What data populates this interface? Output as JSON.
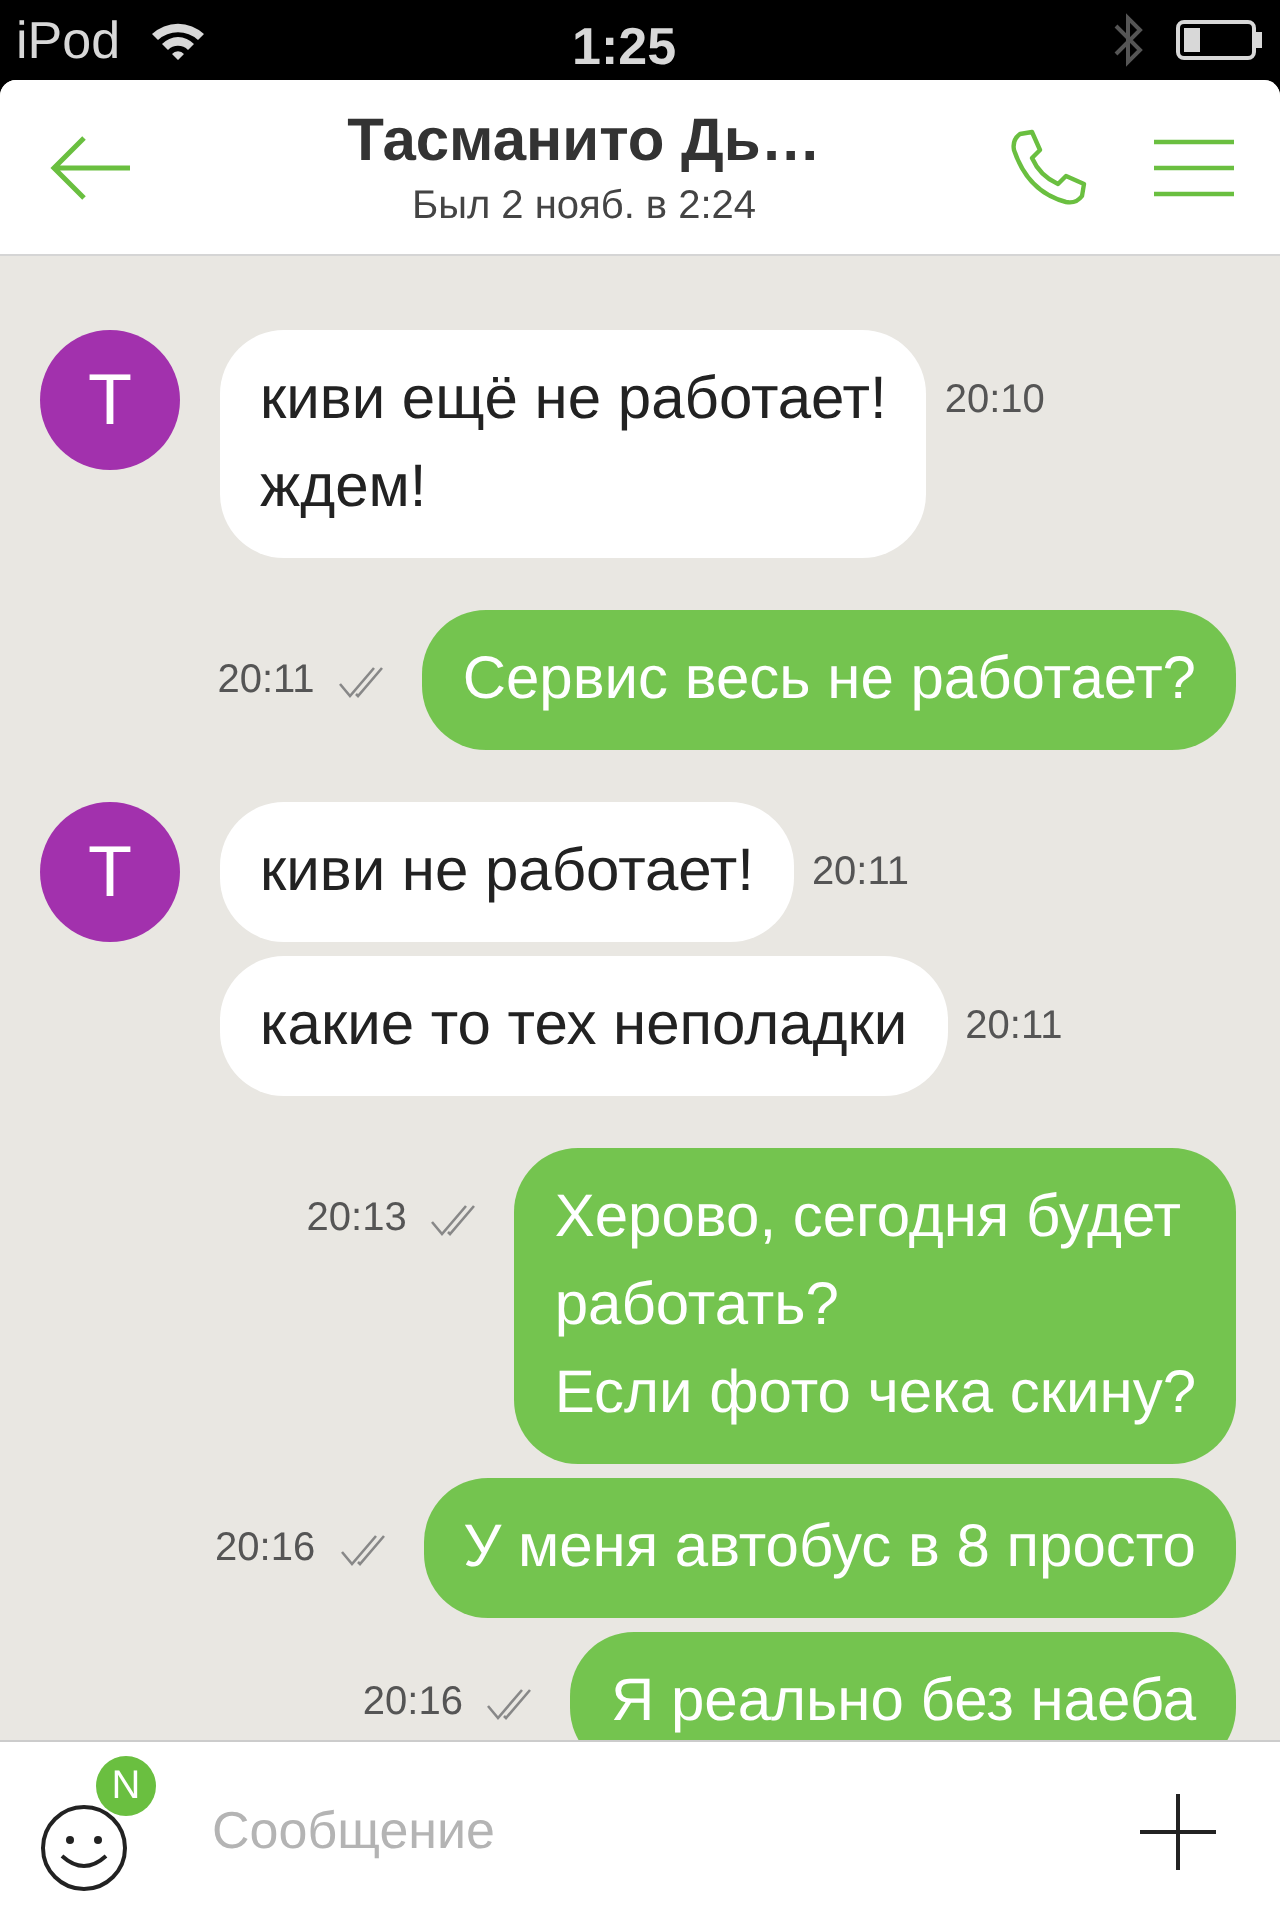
{
  "status_bar": {
    "carrier": "iPod",
    "time": "1:25"
  },
  "header": {
    "title": "Тасманито Дь…",
    "subtitle": "Был 2 нояб. в 2:24"
  },
  "messages": [
    {
      "kind": "incoming",
      "avatar": "Т",
      "text": "киви ещё не работает!\nждем!",
      "time": "20:10"
    },
    {
      "kind": "outgoing",
      "text": "Сервис весь не работает?",
      "time": "20:11",
      "read": true
    },
    {
      "kind": "incoming",
      "avatar": "Т",
      "text": "киви не работает!",
      "time": "20:11"
    },
    {
      "kind": "incoming",
      "text": "какие то тех неполадки",
      "time": "20:11"
    },
    {
      "kind": "outgoing",
      "text": "Херово, сегодня будет\nработать?\nЕсли фото чека скину?",
      "time": "20:13",
      "read": true
    },
    {
      "kind": "outgoing",
      "text": "У меня автобус в 8 просто",
      "time": "20:16",
      "read": true
    },
    {
      "kind": "outgoing",
      "text": "Я реально без наеба",
      "time": "20:16",
      "read": true
    }
  ],
  "composer": {
    "badge": "N",
    "placeholder": "Сообщение"
  }
}
